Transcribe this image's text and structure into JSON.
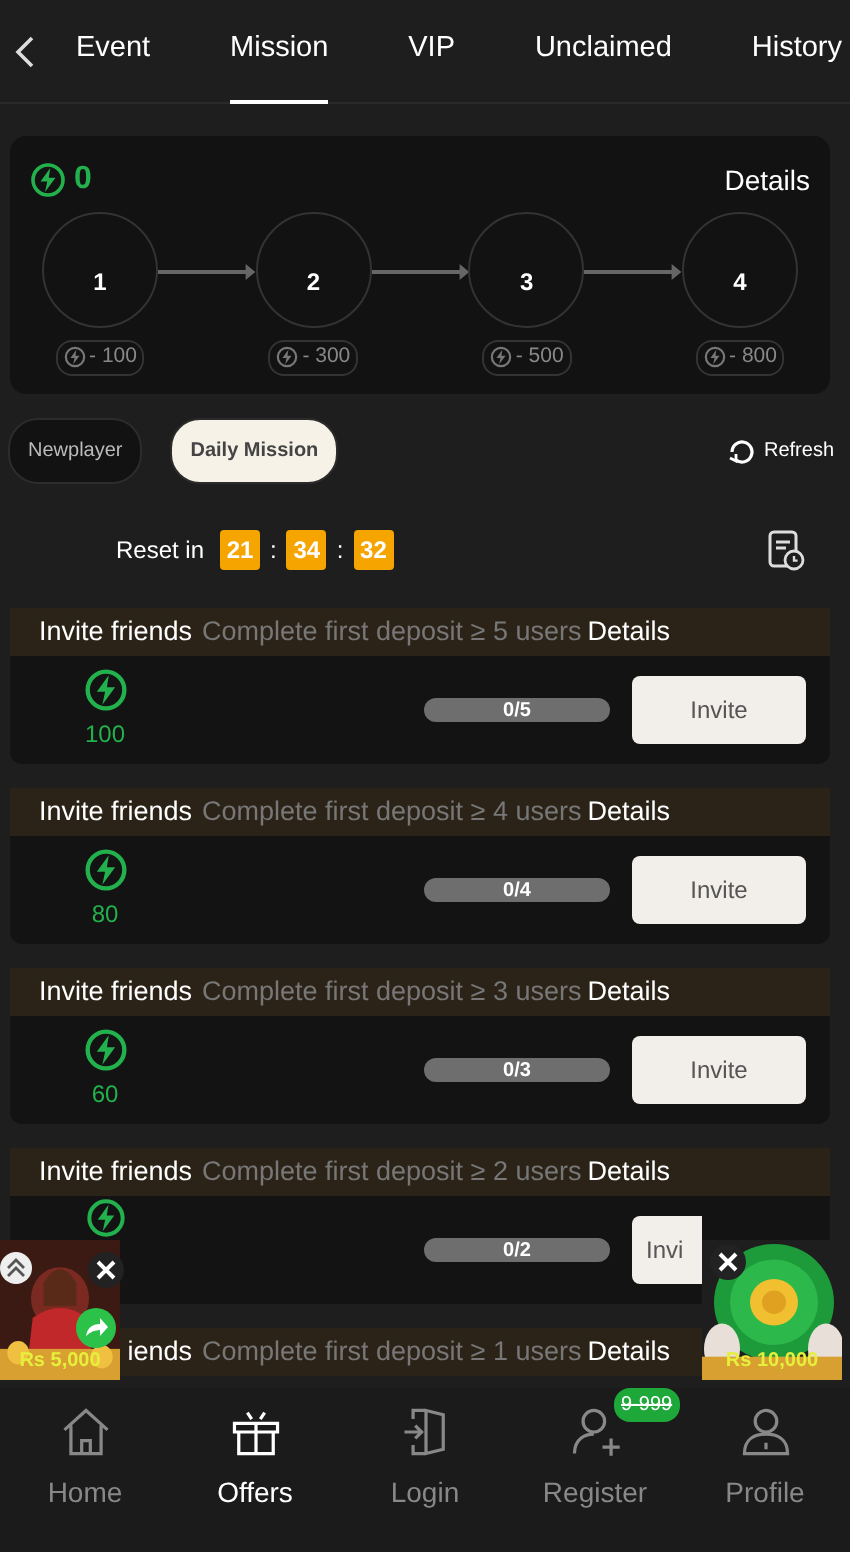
{
  "top_tabs": [
    {
      "label": "Event",
      "selected": false
    },
    {
      "label": "Mission",
      "selected": true
    },
    {
      "label": "VIP",
      "selected": false
    },
    {
      "label": "Unclaimed",
      "selected": false
    },
    {
      "label": "History",
      "selected": false
    }
  ],
  "summary": {
    "points": "0",
    "details": "Details",
    "steps": [
      {
        "number": "1",
        "cost": "- 100"
      },
      {
        "number": "2",
        "cost": "- 300"
      },
      {
        "number": "3",
        "cost": "- 500"
      },
      {
        "number": "4",
        "cost": "- 800"
      }
    ]
  },
  "mission_tabs": [
    {
      "label": "Newplayer",
      "selected": false
    },
    {
      "label": "Daily Mission",
      "selected": true
    }
  ],
  "refresh": "Refresh",
  "reset": {
    "label": "Reset in",
    "hours": "21",
    "minutes": "34",
    "seconds": "32",
    "separator": ":"
  },
  "missions": [
    {
      "title": "Invite friends",
      "description": "Complete first deposit ≥ 5 users",
      "details": "Details",
      "reward": "100",
      "progress": "0/5",
      "level": 0,
      "button": "Invite"
    },
    {
      "title": "Invite friends",
      "description": "Complete first deposit ≥ 4 users",
      "details": "Details",
      "reward": "80",
      "progress": "0/4",
      "level": 0,
      "button": "Invite"
    },
    {
      "title": "Invite friends",
      "description": "Complete first deposit ≥ 3 users",
      "details": "Details",
      "reward": "60",
      "progress": "0/3",
      "level": 0,
      "button": "Invite"
    },
    {
      "title": "Invite friends",
      "description": "Complete first deposit ≥ 2 users",
      "details": "Details",
      "progress": "0/2",
      "level": 0,
      "button": "Invi"
    },
    {
      "title": "iends",
      "description": "Complete first deposit ≥ 1 users",
      "details": "Details"
    }
  ],
  "promos": [
    {
      "amount": "Rs 5,000"
    },
    {
      "amount": "Rs 10,000"
    }
  ],
  "bottom_nav": [
    {
      "label": "Home",
      "selected": false
    },
    {
      "label": "Offers",
      "selected": true
    },
    {
      "label": "Login",
      "selected": false
    },
    {
      "label": "Register",
      "selected": false,
      "badge": "9-999"
    },
    {
      "label": "Profile",
      "selected": false
    }
  ]
}
